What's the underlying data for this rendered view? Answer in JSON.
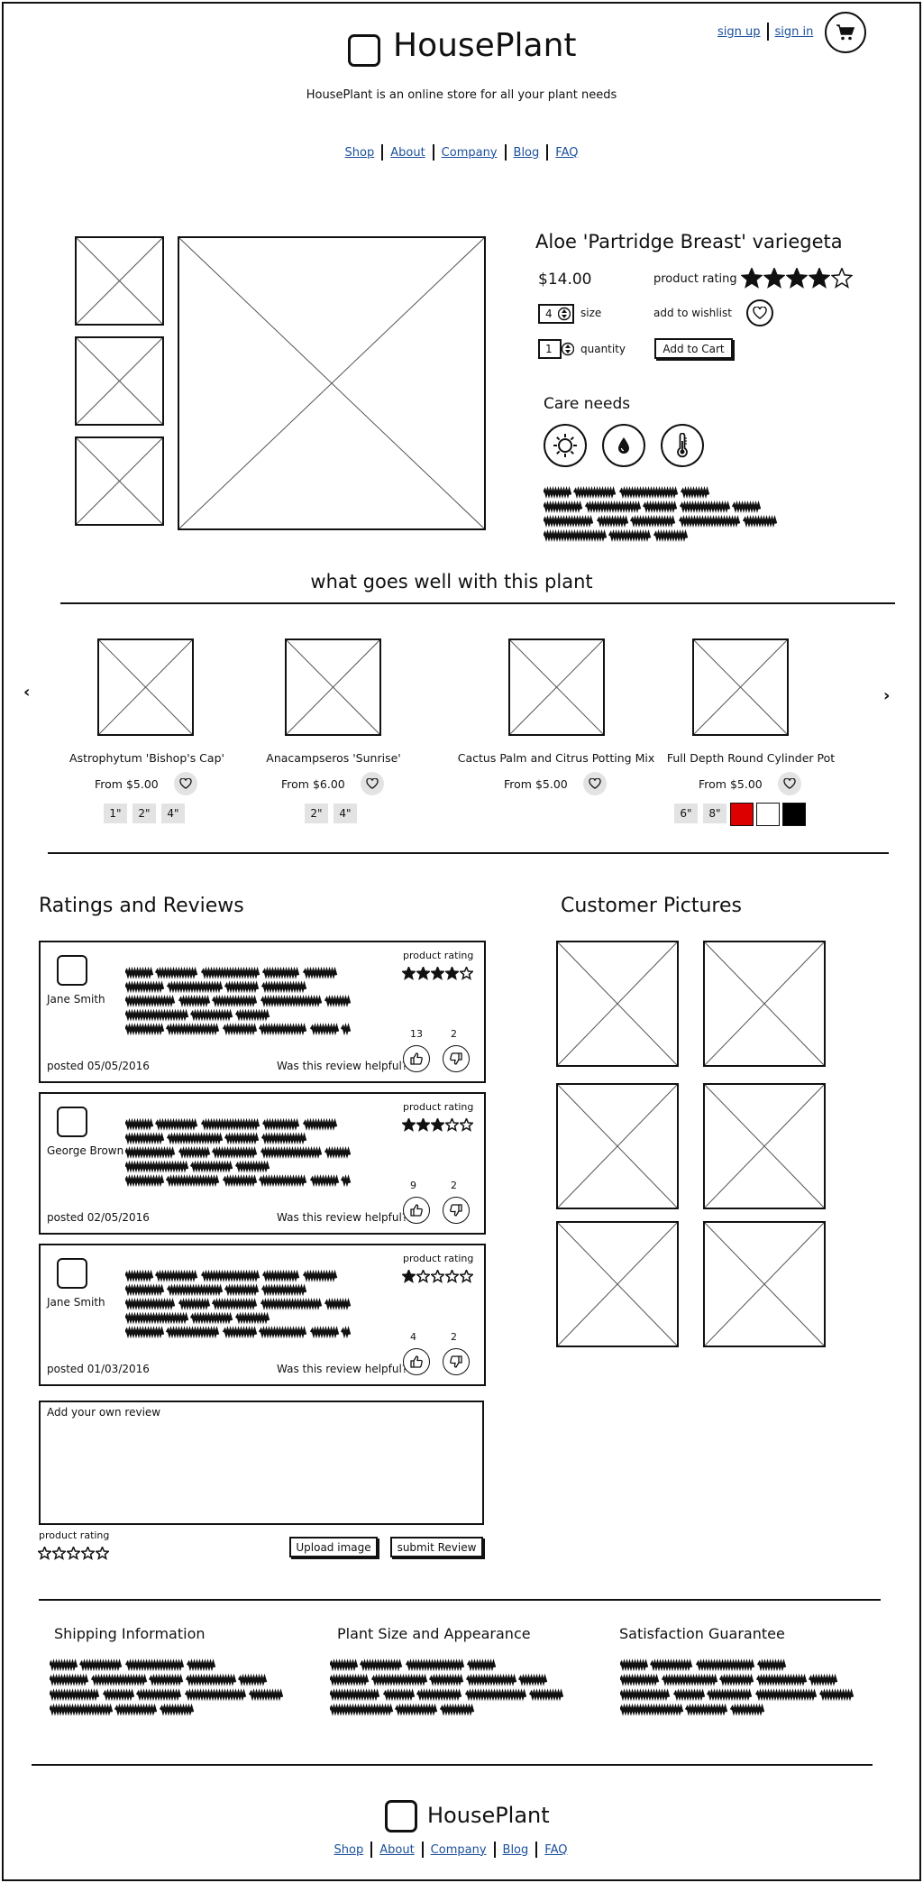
{
  "header": {
    "brand": "HousePlant",
    "tagline": "HousePlant is an online store for all your plant needs",
    "auth": {
      "sign_up": "sign up",
      "sign_in": "sign in"
    },
    "nav": [
      "Shop",
      "About",
      "Company",
      "Blog",
      "FAQ"
    ]
  },
  "product": {
    "title": "Aloe 'Partridge Breast' variegeta",
    "price": "$14.00",
    "rating_label": "product rating",
    "rating_value": 4,
    "rating_max": 5,
    "size_value": "4",
    "size_label": "size",
    "quantity_value": "1",
    "quantity_label": "quantity",
    "wishlist_label": "add to wishlist",
    "add_to_cart": "Add to Cart",
    "care_title": "Care needs",
    "care_icons": [
      "sun-icon",
      "water-drop-icon",
      "thermometer-icon"
    ]
  },
  "related": {
    "title": "what goes well with this plant",
    "items": [
      {
        "name": "Astrophytum 'Bishop's Cap'",
        "price": "From $5.00",
        "sizes": [
          "1\"",
          "2\"",
          "4\""
        ]
      },
      {
        "name": "Anacampseros 'Sunrise'",
        "price": "From $6.00",
        "sizes": [
          "2\"",
          "4\""
        ]
      },
      {
        "name": "Cactus Palm and Citrus Potting Mix",
        "price": "From $5.00",
        "sizes": []
      },
      {
        "name": "Full Depth Round Cylinder Pot",
        "price": "From $5.00",
        "sizes": [
          "6\"",
          "8\""
        ],
        "colors": [
          "#dd0000",
          "#ffffff",
          "#000000"
        ]
      }
    ]
  },
  "reviews": {
    "title": "Ratings and Reviews",
    "rating_label": "product rating",
    "helpful_label": "Was this review helpful?",
    "items": [
      {
        "author": "Jane Smith",
        "posted": "posted 05/05/2016",
        "rating": 4,
        "up": "13",
        "down": "2"
      },
      {
        "author": "George Brown",
        "posted": "posted 02/05/2016",
        "rating": 3,
        "up": "9",
        "down": "2"
      },
      {
        "author": "Jane Smith",
        "posted": "posted 01/03/2016",
        "rating": 1,
        "up": "4",
        "down": "2"
      }
    ],
    "add_placeholder": "Add your own review",
    "own_rating_label": "product rating",
    "upload_label": "Upload image",
    "submit_label": "submit Review"
  },
  "pictures": {
    "title": "Customer Pictures"
  },
  "info": [
    {
      "title": "Shipping Information"
    },
    {
      "title": "Plant Size and Appearance"
    },
    {
      "title": "Satisfaction Guarantee"
    }
  ],
  "footer": {
    "brand": "HousePlant",
    "nav": [
      "Shop",
      "About",
      "Company",
      "Blog",
      "FAQ"
    ]
  }
}
